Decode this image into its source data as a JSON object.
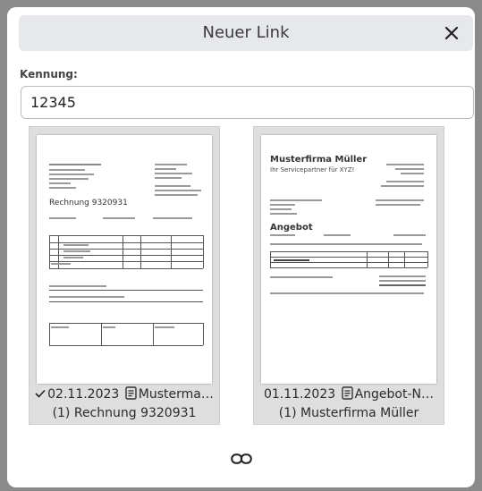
{
  "dialog": {
    "title": "Neuer Link",
    "close_icon": "close-icon"
  },
  "form": {
    "label": "Kennung:",
    "value": "12345"
  },
  "cards": [
    {
      "selected": true,
      "date": "02.11.2023",
      "doc_title": "Musterma…",
      "subtitle": "(1) Rechnung 9320931",
      "thumb": {
        "heading": "Rechnung 9320931"
      }
    },
    {
      "selected": false,
      "date": "01.11.2023",
      "doc_title": "Angebot-N…",
      "subtitle": "(1) Musterfirma Müller",
      "thumb": {
        "heading": "Musterfirma Müller",
        "tagline": "Ihr Servicepartner für XYZ!",
        "section": "Angebot"
      }
    }
  ],
  "footer": {
    "link_icon": "link-icon"
  }
}
